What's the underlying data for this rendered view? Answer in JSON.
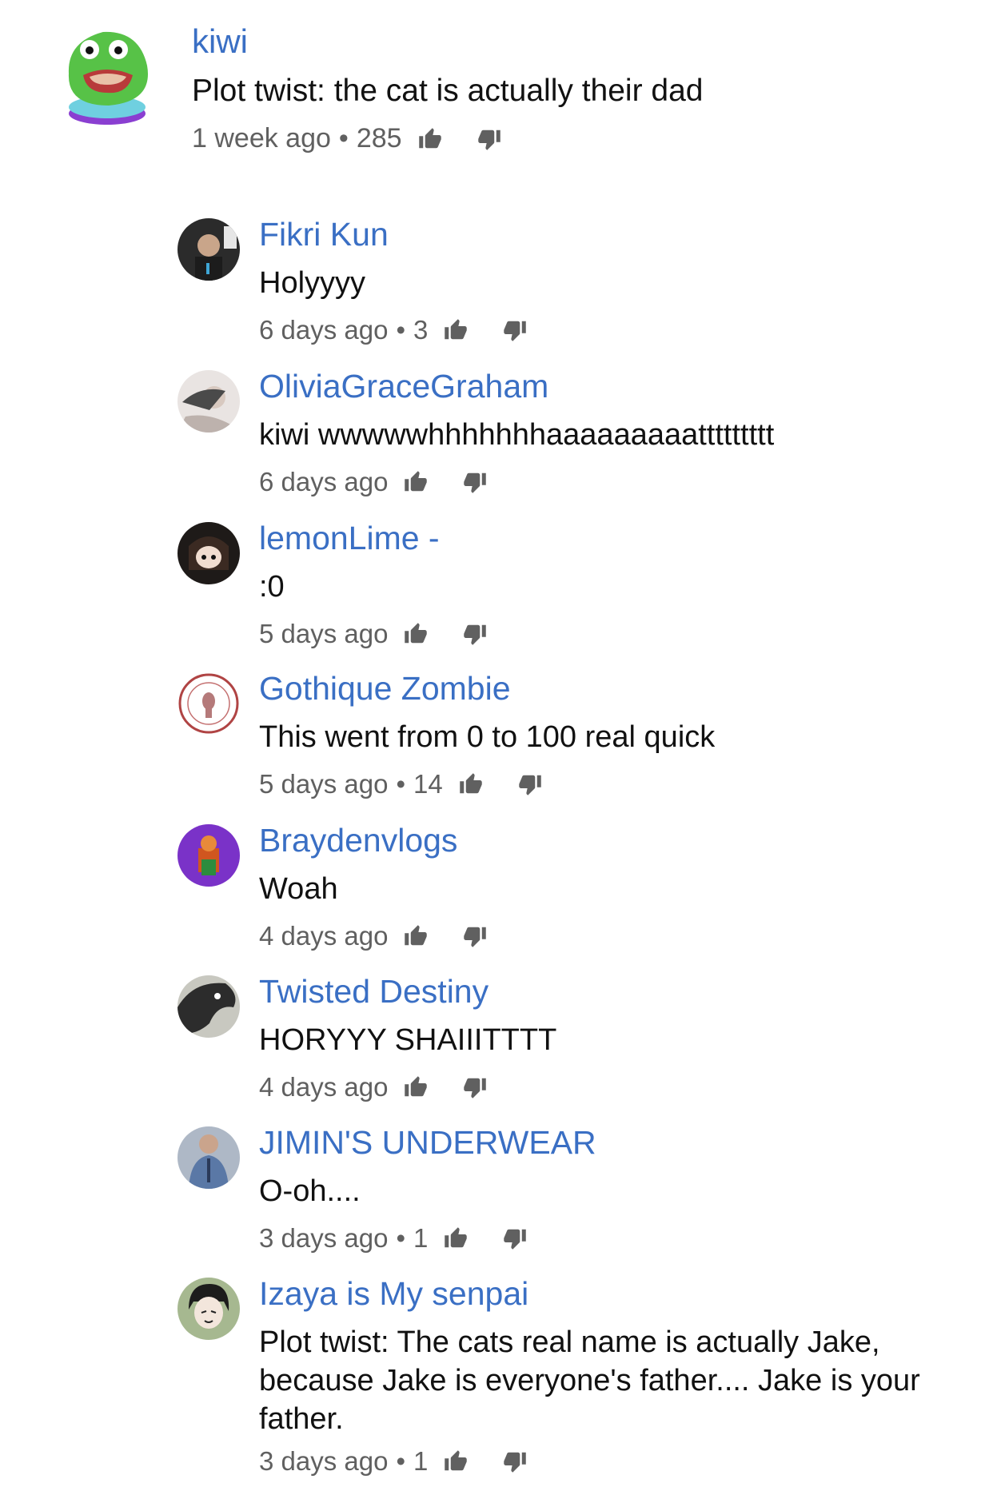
{
  "top_comment": {
    "author": "kiwi",
    "text": "Plot twist: the cat is actually their dad",
    "time": "1 week ago",
    "likes": "285"
  },
  "replies": [
    {
      "author": "Fikri Kun",
      "text": "Holyyyy",
      "time": "6 days ago",
      "likes": "3"
    },
    {
      "author": "OliviaGraceGraham",
      "text": "kiwi wwwwwhhhhhhhaaaaaaaaattttttttt",
      "time": "6 days ago",
      "likes": ""
    },
    {
      "author": "lemonLime -",
      "text": ":0",
      "time": "5 days ago",
      "likes": ""
    },
    {
      "author": "Gothique Zombie",
      "text": "This went from 0 to 100 real quick",
      "time": "5 days ago",
      "likes": "14"
    },
    {
      "author": "Braydenvlogs",
      "text": "Woah",
      "time": "4 days ago",
      "likes": ""
    },
    {
      "author": "Twisted Destiny",
      "text": "HORYYY SHAIIITTTT",
      "time": "4 days ago",
      "likes": ""
    },
    {
      "author": "JIMIN'S UNDERWEAR",
      "text": "O-oh....",
      "time": "3 days ago",
      "likes": "1"
    },
    {
      "author": "Izaya is My senpai",
      "text": "Plot twist: The cats real name is actually Jake, because Jake is everyone's father.... Jake is your father.",
      "time": "3 days ago",
      "likes": "1"
    }
  ],
  "separator": "•",
  "icons": {
    "like": "thumbs-up-icon",
    "dislike": "thumbs-down-icon"
  },
  "colors": {
    "author": "#3a6fc4",
    "text": "#111111",
    "meta": "#606060",
    "icon": "#606060"
  }
}
